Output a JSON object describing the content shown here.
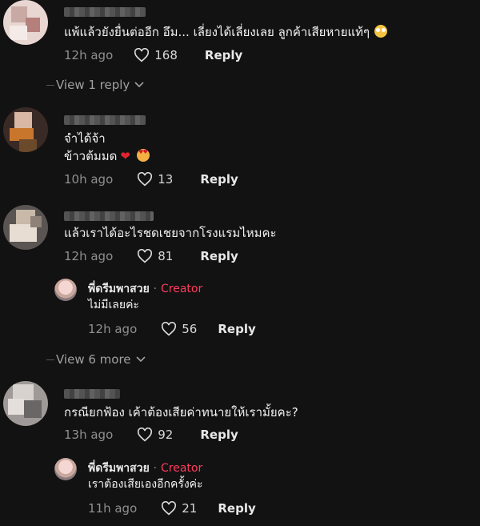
{
  "comments": [
    {
      "text": "แพ้แล้วยังยื่นต่ออีก อึม... เลี่ยงได้เลี่ยงเลย ลูกค้าเสียหายแท้ๆ",
      "emoji": "face-with-rolling-eyes",
      "time": "12h ago",
      "likes": "168",
      "reply_label": "Reply",
      "view_replies": "View 1 reply"
    },
    {
      "text_line1": "จำได้จ้า",
      "text_line2": "ข้าวต้มมด",
      "emoji": "heart, smiling-face-with-hearts",
      "time": "10h ago",
      "likes": "13",
      "reply_label": "Reply"
    },
    {
      "text": "แล้วเราได้อะไรชดเชยจากโรงแรมไหมคะ",
      "time": "12h ago",
      "likes": "81",
      "reply_label": "Reply",
      "reply": {
        "name": "พี่ดรีมพาสวย",
        "separator": "·",
        "badge": "Creator",
        "text": "ไม่มีเลยค่ะ",
        "time": "12h ago",
        "likes": "56",
        "reply_label": "Reply"
      },
      "view_more": "View 6 more"
    },
    {
      "text": "กรณียกฟ้อง เค้าต้องเสียค่าทนายให้เรามั้ยคะ?",
      "time": "13h ago",
      "likes": "92",
      "reply_label": "Reply",
      "reply": {
        "name": "พี่ดรีมพาสวย",
        "separator": "·",
        "badge": "Creator",
        "text": "เราต้องเสียเองอีกครั้งค่ะ",
        "time": "11h ago",
        "likes": "21",
        "reply_label": "Reply"
      }
    }
  ],
  "colors": {
    "background": "#121212",
    "creator_badge": "#ff3b5c",
    "muted": "#8f8f8f"
  }
}
